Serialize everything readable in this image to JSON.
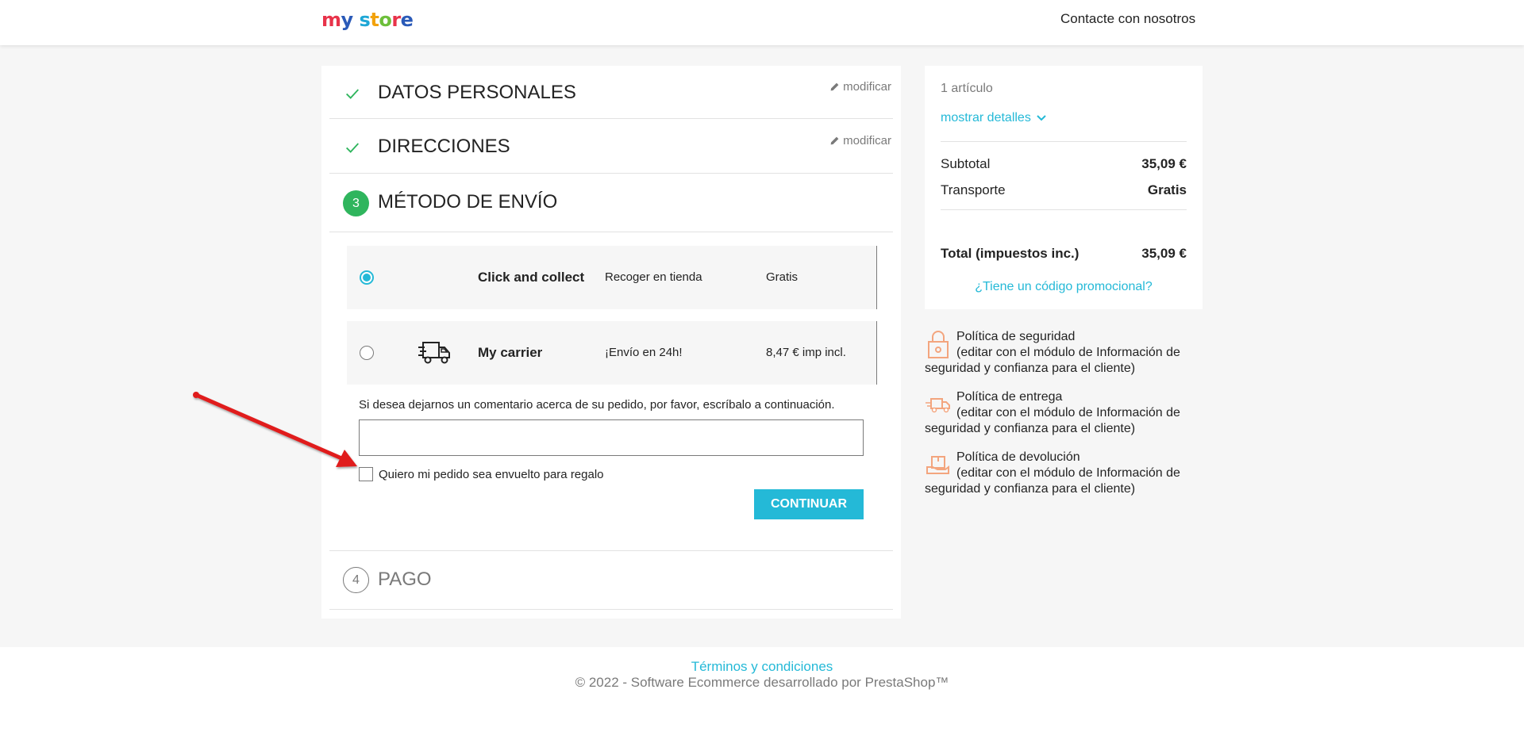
{
  "header": {
    "logo_text": "my store",
    "contact_link": "Contacte con nosotros"
  },
  "steps": {
    "personal": {
      "title": "Datos personales",
      "edit": "modificar"
    },
    "addresses": {
      "title": "Direcciones",
      "edit": "modificar"
    },
    "shipping": {
      "number": "3",
      "title": "Método de envío"
    },
    "payment": {
      "number": "4",
      "title": "Pago"
    }
  },
  "carriers": [
    {
      "name": "Click and collect",
      "delay": "Recoger en tienda",
      "price": "Gratis",
      "selected": true
    },
    {
      "name": "My carrier",
      "delay": "¡Envío en 24h!",
      "price": "8,47 € imp incl.",
      "selected": false
    }
  ],
  "comment": {
    "label": "Si desea dejarnos un comentario acerca de su pedido, por favor, escríbalo a continuación.",
    "value": ""
  },
  "gift": {
    "label": "Quiero mi pedido sea envuelto para regalo"
  },
  "continue_button": "Continuar",
  "summary": {
    "items_count": "1 artículo",
    "show_details": "mostrar detalles",
    "subtotal_label": "Subtotal",
    "subtotal_value": "35,09 €",
    "shipping_label": "Transporte",
    "shipping_value": "Gratis",
    "total_label": "Total (impuestos inc.)",
    "total_value": "35,09 €",
    "promo_link": "¿Tiene un código promocional?"
  },
  "reassurance": [
    {
      "title": "Política de seguridad",
      "text": "(editar con el módulo de Información de seguridad y confianza para el cliente)",
      "icon": "lock-icon"
    },
    {
      "title": "Política de entrega",
      "text": "(editar con el módulo de Información de seguridad y confianza para el cliente)",
      "icon": "delivery-truck-icon"
    },
    {
      "title": "Política de devolución",
      "text": "(editar con el módulo de Información de seguridad y confianza para el cliente)",
      "icon": "return-box-icon"
    }
  ],
  "footer": {
    "terms": "Términos y condiciones",
    "copyright": "© 2022 - Software Ecommerce desarrollado por PrestaShop™"
  },
  "colors": {
    "accent": "#24b9d7",
    "success": "#2fb55d",
    "annotation": "#e01b1b"
  }
}
